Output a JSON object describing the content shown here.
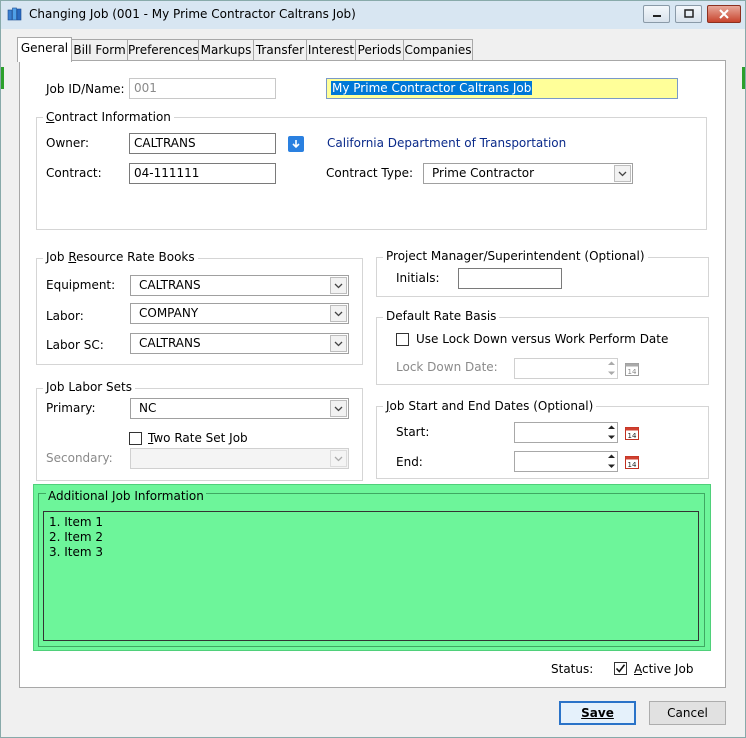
{
  "window": {
    "title": "Changing Job  (001 - My Prime Contractor Caltrans Job)",
    "icon": "book-stack-icon"
  },
  "tabs": [
    {
      "label": "General",
      "active": true
    },
    {
      "label": "Bill Form"
    },
    {
      "label": "Preferences"
    },
    {
      "label": "Markups"
    },
    {
      "label": "Transfer"
    },
    {
      "label": "Interest"
    },
    {
      "label": "Periods"
    },
    {
      "label": "Companies"
    }
  ],
  "job": {
    "id_label": "Job ID/Name:",
    "id_value": "001",
    "name_value": "My Prime Contractor Caltrans Job"
  },
  "contract_info": {
    "title": "Contract Information",
    "owner_label": "Owner:",
    "owner_value": "CALTRANS",
    "owner_link": "California Department of Transportation",
    "contract_label": "Contract:",
    "contract_value": "04-111111",
    "type_label": "Contract Type:",
    "type_value": "Prime Contractor"
  },
  "rate_books": {
    "title": "Job Resource Rate Books",
    "equipment_label": "Equipment:",
    "equipment_value": "CALTRANS",
    "labor_label": "Labor:",
    "labor_value": "COMPANY",
    "labor_sc_label": "Labor SC:",
    "labor_sc_value": "CALTRANS"
  },
  "labor_sets": {
    "title": "Job Labor Sets",
    "primary_label": "Primary:",
    "primary_value": "NC",
    "two_rate_label": "Two Rate Set Job",
    "two_rate_checked": false,
    "secondary_label": "Secondary:",
    "secondary_value": ""
  },
  "project_manager": {
    "title": "Project Manager/Superintendent (Optional)",
    "initials_label": "Initials:",
    "initials_value": ""
  },
  "rate_basis": {
    "title": "Default Rate Basis",
    "lockdown_label": "Use Lock Down versus Work Perform Date",
    "lockdown_checked": false,
    "lockdown_date_label": "Lock Down Date:",
    "lockdown_date_value": ""
  },
  "dates": {
    "title": "Job Start and End Dates (Optional)",
    "start_label": "Start:",
    "start_value": "",
    "end_label": "End:",
    "end_value": ""
  },
  "additional_info": {
    "title": "Additional Job Information",
    "lines": [
      "1. Item 1",
      "2. Item 2",
      "3. Item 3"
    ]
  },
  "status": {
    "label": "Status:",
    "active_label": "Active Job",
    "active_checked": true
  },
  "buttons": {
    "save": "Save",
    "cancel": "Cancel"
  },
  "colors": {
    "highlight_field": "#ffff99",
    "selection": "#0078d7",
    "additional_bg": "#6df59a"
  }
}
